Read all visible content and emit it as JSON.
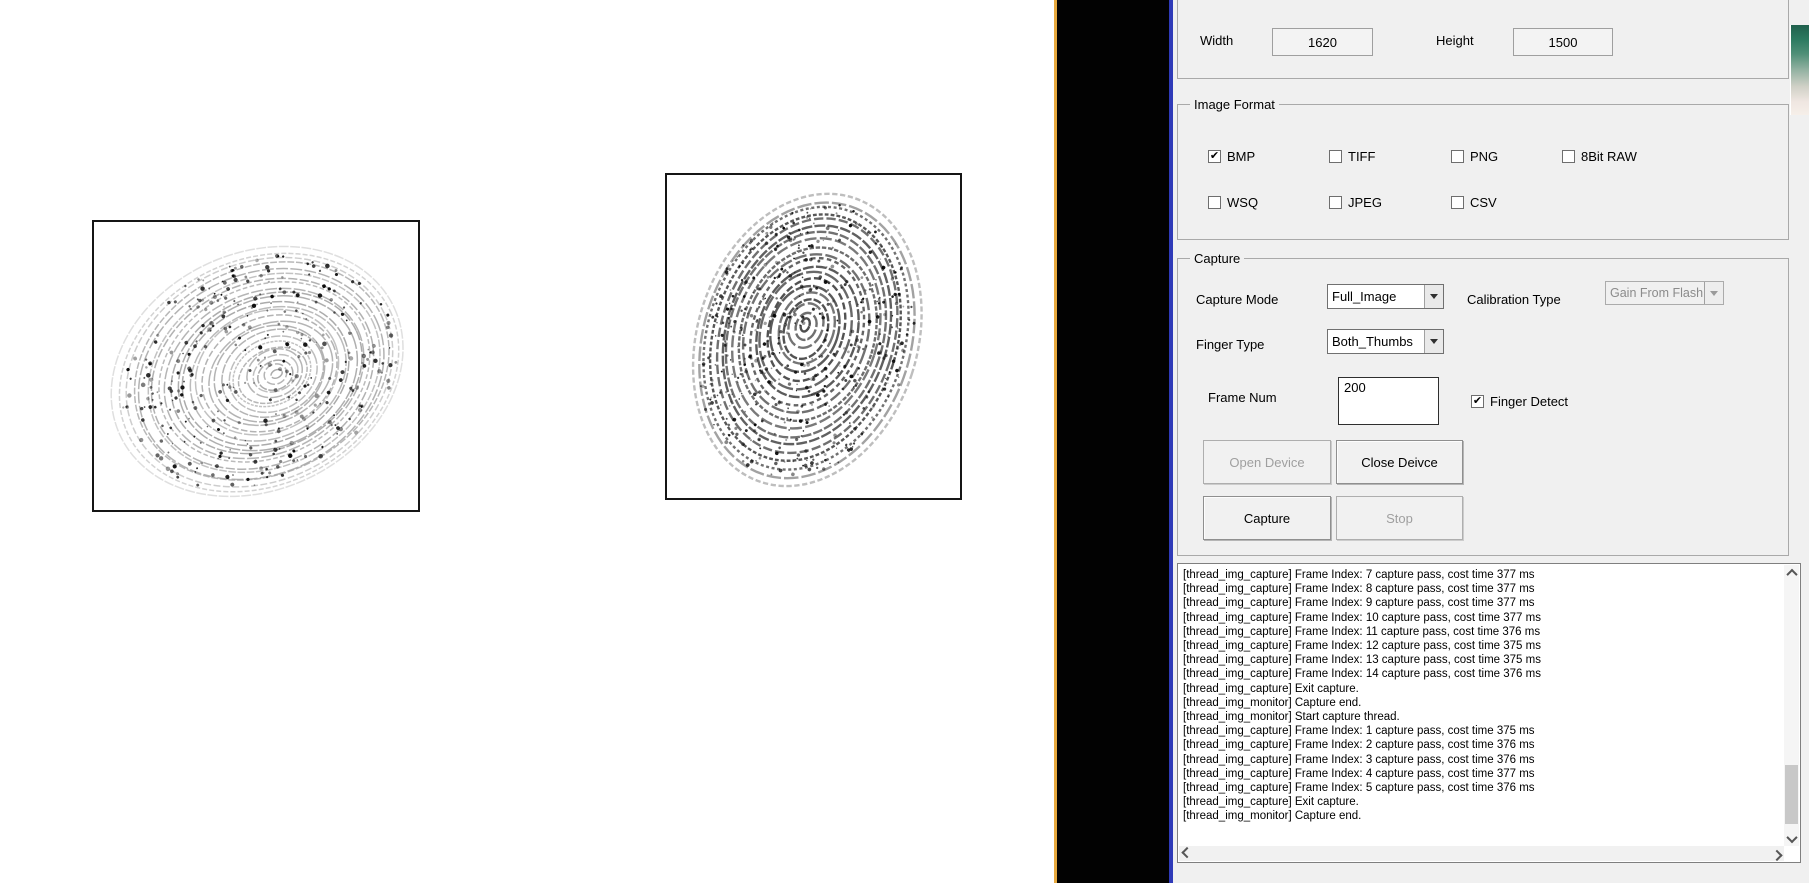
{
  "window": {
    "width_label": "Width",
    "width_value": "1620",
    "height_label": "Height",
    "height_value": "1500"
  },
  "image_format": {
    "title": "Image Format",
    "options": [
      {
        "label": "BMP",
        "checked": true
      },
      {
        "label": "TIFF",
        "checked": false
      },
      {
        "label": "PNG",
        "checked": false
      },
      {
        "label": "8Bit RAW",
        "checked": false
      },
      {
        "label": "WSQ",
        "checked": false
      },
      {
        "label": "JPEG",
        "checked": false
      },
      {
        "label": "CSV",
        "checked": false
      }
    ]
  },
  "capture": {
    "title": "Capture",
    "capture_mode_label": "Capture Mode",
    "capture_mode_value": "Full_Image",
    "calibration_type_label": "Calibration Type",
    "calibration_type_value": "Gain From Flash",
    "calibration_type_enabled": false,
    "finger_type_label": "Finger Type",
    "finger_type_value": "Both_Thumbs",
    "frame_num_label": "Frame Num",
    "frame_num_value": "200",
    "finger_detect_label": "Finger Detect",
    "finger_detect_checked": true,
    "buttons": {
      "open_device": {
        "label": "Open Device",
        "enabled": false
      },
      "close_device": {
        "label": "Close Deivce",
        "enabled": true
      },
      "capture": {
        "label": "Capture",
        "enabled": true
      },
      "stop": {
        "label": "Stop",
        "enabled": false
      }
    }
  },
  "log": {
    "lines": [
      "[thread_img_capture] Frame Index: 7 capture pass, cost time 377 ms",
      "[thread_img_capture] Frame Index: 8 capture pass, cost time 377 ms",
      "[thread_img_capture] Frame Index: 9 capture pass, cost time 377 ms",
      "[thread_img_capture] Frame Index: 10 capture pass, cost time 377 ms",
      "[thread_img_capture] Frame Index: 11 capture pass, cost time 376 ms",
      "[thread_img_capture] Frame Index: 12 capture pass, cost time 375 ms",
      "[thread_img_capture] Frame Index: 13 capture pass, cost time 375 ms",
      "[thread_img_capture] Frame Index: 14 capture pass, cost time 376 ms",
      "[thread_img_capture] Exit capture.",
      "[thread_img_monitor] Capture end.",
      "[thread_img_monitor] Start capture thread.",
      "[thread_img_capture] Frame Index: 1 capture pass, cost time 375 ms",
      "[thread_img_capture] Frame Index: 2 capture pass, cost time 376 ms",
      "[thread_img_capture] Frame Index: 3 capture pass, cost time 376 ms",
      "[thread_img_capture] Frame Index: 4 capture pass, cost time 377 ms",
      "[thread_img_capture] Frame Index: 5 capture pass, cost time 376 ms",
      "[thread_img_capture] Exit capture.",
      "[thread_img_monitor] Capture end."
    ]
  },
  "previews": [
    {
      "id": "left-thumb-fingerprint"
    },
    {
      "id": "right-thumb-fingerprint"
    }
  ],
  "colors": {
    "panel_bg": "#f0f0f0",
    "window_border_blue": "#2f3ab8",
    "divider_orange": "#e7a93f",
    "divider_black": "#020202"
  }
}
